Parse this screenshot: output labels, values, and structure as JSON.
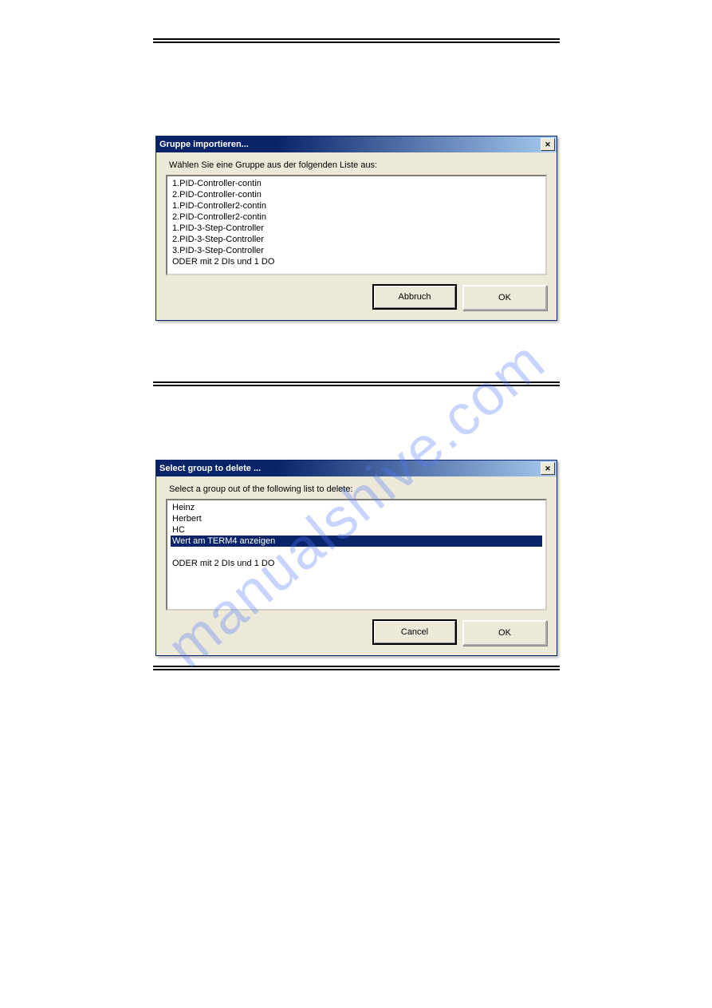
{
  "watermark": "manualshive.com",
  "dialog1": {
    "title": "Gruppe importieren...",
    "prompt": "Wählen Sie eine Gruppe aus der folgenden Liste aus:",
    "items": [
      "1.PID-Controller-contin",
      "2.PID-Controller-contin",
      "1.PID-Controller2-contin",
      "2.PID-Controller2-contin",
      "1.PID-3-Step-Controller",
      "2.PID-3-Step-Controller",
      "3.PID-3-Step-Controller",
      "ODER mit 2 DIs und 1 DO"
    ],
    "cancel": "Abbruch",
    "ok": "OK"
  },
  "dialog2": {
    "title": "Select group to delete ...",
    "prompt": "Select a group out of the following list to delete:",
    "items": [
      {
        "text": "Heinz",
        "selected": false
      },
      {
        "text": "Herbert",
        "selected": false
      },
      {
        "text": "HC",
        "selected": false
      },
      {
        "text": "Wert am TERM4 anzeigen",
        "selected": true
      },
      {
        "text": "",
        "selected": false
      },
      {
        "text": "ODER mit 2 DIs und 1 DO",
        "selected": false
      }
    ],
    "cancel": "Cancel",
    "ok": "OK"
  }
}
